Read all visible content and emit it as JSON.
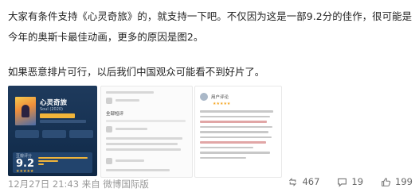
{
  "post": {
    "paragraph1": "大家有条件支持《心灵奇旅》的，就支持一下吧。不仅因为这是一部9.2分的佳作，很可能是今年的奥斯卡最佳动画，更多的原因是图2。",
    "paragraph2": "如果恶意排片可行，以后我们中国观众可能看不到好片了。"
  },
  "images": {
    "image1": {
      "title": "心灵奇旅",
      "subtitle": "Soul (2020)",
      "rating_label": "豆瓣评分",
      "rating_score": "9.2",
      "stars": "★★★★★"
    },
    "image2": {
      "section_label": "全部短评"
    },
    "image3": {
      "commenter": "用户评论",
      "stars": "★★★★★"
    }
  },
  "footer": {
    "timestamp": "12月27日 21:43 来自 微博国际版",
    "reposts": "467",
    "comments": "19",
    "likes": "199"
  },
  "icons": {
    "repost": "repost-icon",
    "comment": "comment-icon",
    "like": "like-icon"
  }
}
